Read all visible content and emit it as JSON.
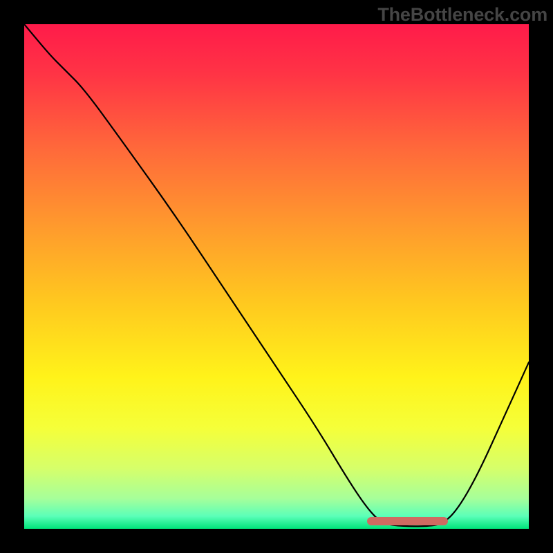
{
  "watermark": "TheBottleneck.com",
  "chart_data": {
    "type": "line",
    "title": "",
    "xlabel": "",
    "ylabel": "",
    "xlim": [
      0,
      100
    ],
    "ylim": [
      0,
      100
    ],
    "grid": false,
    "legend": false,
    "background": {
      "type": "vertical-gradient",
      "stops": [
        {
          "pos": 0.0,
          "color": "#ff1b4a"
        },
        {
          "pos": 0.1,
          "color": "#ff3445"
        },
        {
          "pos": 0.25,
          "color": "#ff6a3a"
        },
        {
          "pos": 0.4,
          "color": "#ff9a2d"
        },
        {
          "pos": 0.55,
          "color": "#ffc81f"
        },
        {
          "pos": 0.7,
          "color": "#fff31a"
        },
        {
          "pos": 0.8,
          "color": "#f5ff39"
        },
        {
          "pos": 0.88,
          "color": "#d6ff6a"
        },
        {
          "pos": 0.94,
          "color": "#a6ff9a"
        },
        {
          "pos": 0.975,
          "color": "#5bffb8"
        },
        {
          "pos": 1.0,
          "color": "#00e47a"
        }
      ]
    },
    "series": [
      {
        "name": "bottleneck-curve",
        "stroke": "#000000",
        "points": [
          {
            "x": 0,
            "y": 100
          },
          {
            "x": 5,
            "y": 94
          },
          {
            "x": 8,
            "y": 91
          },
          {
            "x": 12,
            "y": 87
          },
          {
            "x": 20,
            "y": 76
          },
          {
            "x": 30,
            "y": 62
          },
          {
            "x": 40,
            "y": 47
          },
          {
            "x": 50,
            "y": 32
          },
          {
            "x": 58,
            "y": 20
          },
          {
            "x": 64,
            "y": 10
          },
          {
            "x": 68,
            "y": 4
          },
          {
            "x": 71,
            "y": 1
          },
          {
            "x": 75,
            "y": 0.5
          },
          {
            "x": 80,
            "y": 0.5
          },
          {
            "x": 83,
            "y": 1
          },
          {
            "x": 86,
            "y": 4
          },
          {
            "x": 90,
            "y": 11
          },
          {
            "x": 95,
            "y": 22
          },
          {
            "x": 100,
            "y": 33
          }
        ]
      }
    ],
    "annotations": [
      {
        "name": "valley-highlight",
        "type": "segment",
        "color": "#cf6a61",
        "x_start": 68,
        "x_end": 84,
        "y": 1.5
      }
    ]
  }
}
